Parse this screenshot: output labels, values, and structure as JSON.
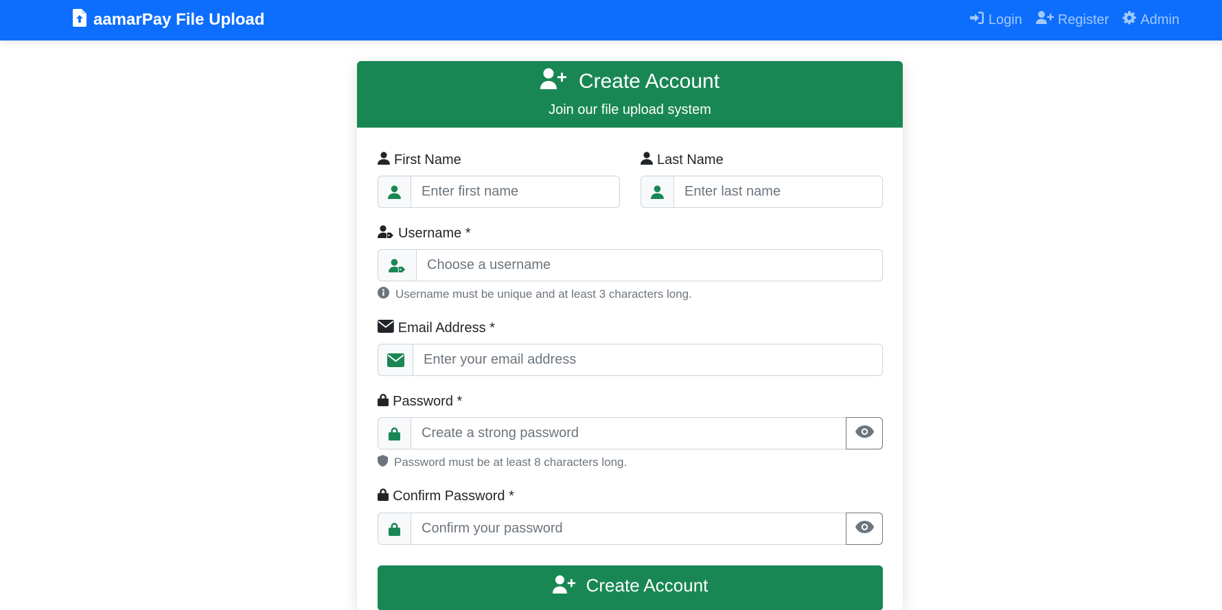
{
  "navbar": {
    "brand": "aamarPay File Upload",
    "brand_icon": "file-upload-icon",
    "links": [
      {
        "label": "Login",
        "icon": "sign-in-icon"
      },
      {
        "label": "Register",
        "icon": "user-plus-icon"
      },
      {
        "label": "Admin",
        "icon": "gear-icon"
      }
    ]
  },
  "card": {
    "title": "Create Account",
    "subtitle": "Join our file upload system",
    "header_color": "#198754"
  },
  "form": {
    "first_name": {
      "label": "First Name",
      "placeholder": "Enter first name",
      "value": ""
    },
    "last_name": {
      "label": "Last Name",
      "placeholder": "Enter last name",
      "value": ""
    },
    "username": {
      "label": "Username *",
      "placeholder": "Choose a username",
      "value": "",
      "help": "Username must be unique and at least 3 characters long."
    },
    "email": {
      "label": "Email Address *",
      "placeholder": "Enter your email address",
      "value": ""
    },
    "password": {
      "label": "Password *",
      "placeholder": "Create a strong password",
      "value": "",
      "help": "Password must be at least 8 characters long."
    },
    "confirm_password": {
      "label": "Confirm Password *",
      "placeholder": "Confirm your password",
      "value": ""
    },
    "submit_label": "Create Account"
  },
  "colors": {
    "navbar": "#0d6efd",
    "success": "#198754",
    "muted": "#6c757d"
  }
}
